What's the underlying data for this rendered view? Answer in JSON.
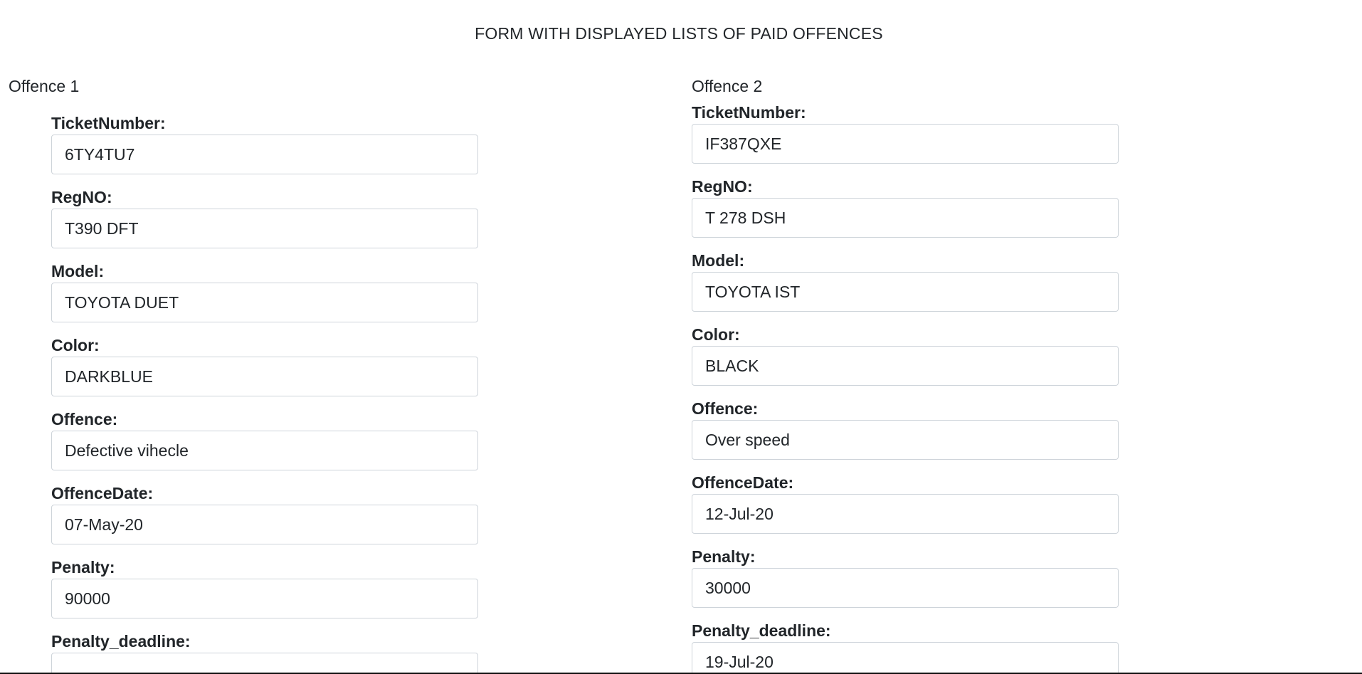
{
  "page": {
    "title": "FORM WITH DISPLAYED LISTS OF PAID OFFENCES"
  },
  "labels": {
    "ticket_number": "TicketNumber:",
    "reg_no": "RegNO:",
    "model": "Model:",
    "color": "Color:",
    "offence": "Offence:",
    "offence_date": "OffenceDate:",
    "penalty": "Penalty:",
    "penalty_deadline": "Penalty_deadline:"
  },
  "offences": [
    {
      "heading": "Offence 1",
      "ticket_number": "6TY4TU7",
      "reg_no": "T390 DFT",
      "model": "TOYOTA DUET",
      "color": "DARKBLUE",
      "offence": "Defective vihecle",
      "offence_date": "07-May-20",
      "penalty": "90000",
      "penalty_deadline": ""
    },
    {
      "heading": "Offence 2",
      "ticket_number": "IF387QXE",
      "reg_no": "T 278 DSH",
      "model": "TOYOTA IST",
      "color": "BLACK",
      "offence": "Over speed",
      "offence_date": "12-Jul-20",
      "penalty": "30000",
      "penalty_deadline": "19-Jul-20"
    }
  ],
  "colors": {
    "text": "#212529",
    "input_border": "#ced4da",
    "background": "#ffffff"
  }
}
